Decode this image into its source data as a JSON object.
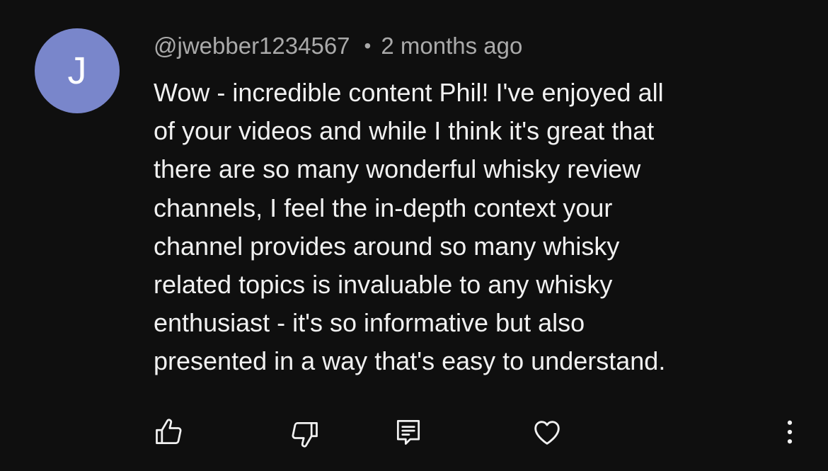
{
  "comment": {
    "avatar_letter": "J",
    "author": "@jwebber1234567",
    "separator": "•",
    "timestamp": "2 months ago",
    "text_lines": [
      "Wow - incredible content Phil! I've enjoyed all",
      "of your videos and while I think it's great that",
      "there are so many wonderful whisky review",
      "channels, I feel the in-depth context your",
      "channel provides around so many whisky",
      "related topics is invaluable to any whisky",
      "enthusiast - it's so informative but also",
      "presented in a way that's easy to understand."
    ],
    "avatar_color": "#7986cb"
  },
  "actions": {
    "icons": [
      "thumbs-up-icon",
      "thumbs-down-icon",
      "reply-icon",
      "heart-icon",
      "more-vertical-icon"
    ]
  }
}
